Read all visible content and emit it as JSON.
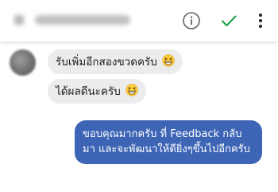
{
  "header": {
    "info_icon": "info-circle-icon",
    "check_icon": "check-icon",
    "more_icon": "more-vertical-icon",
    "accent_color": "#1a9e45"
  },
  "messages": [
    {
      "direction": "incoming",
      "text": "รับเพิ่มอีกสองขวดครับ",
      "emoji": "grinning-squinting-face"
    },
    {
      "direction": "incoming",
      "text": "ได้ผลดีนะครับ",
      "emoji": "grinning-squinting-face"
    },
    {
      "direction": "outgoing",
      "text": "ขอบคุณมากครับ ที่ Feedback กลับมา และจะพัฒนาให้ดียิ่งๆขึ้นไปอีกครับ"
    }
  ],
  "colors": {
    "incoming_bubble": "#ececec",
    "outgoing_bubble": "#3d64b5"
  }
}
